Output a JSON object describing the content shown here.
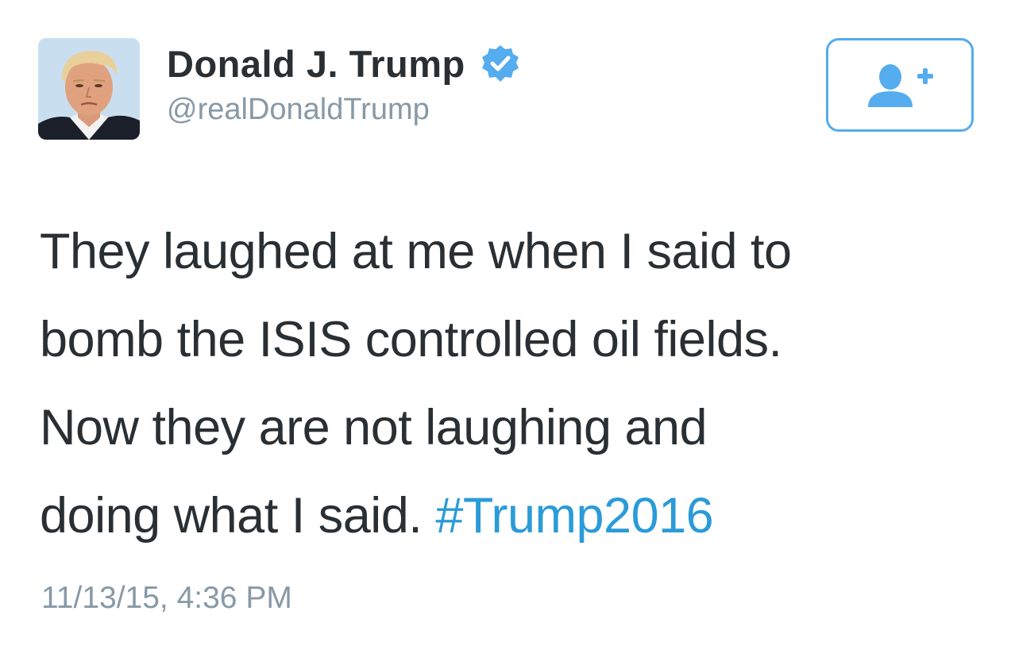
{
  "tweet": {
    "author": {
      "display_name": "Donald J. Trump",
      "handle": "@realDonaldTrump",
      "verified": true,
      "verified_icon": "verified-badge-icon",
      "avatar": "profile-photo"
    },
    "follow_button": {
      "icon": "add-user-icon"
    },
    "text_lines": [
      "They laughed at me when I said to",
      "bomb the ISIS controlled oil fields.",
      "Now they are not laughing and",
      "doing what I said. "
    ],
    "hashtag": "#Trump2016",
    "timestamp": "11/13/15, 4:36 PM"
  },
  "colors": {
    "text": "#292f33",
    "secondary": "#8899a6",
    "accent": "#55acee",
    "hashtag": "#2b9bd8"
  }
}
